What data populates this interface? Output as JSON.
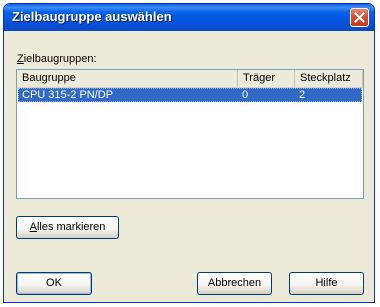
{
  "window": {
    "title": "Zielbaugruppe auswählen"
  },
  "group": {
    "label_mnemonic": "Z",
    "label_rest": "ielbaugruppen:"
  },
  "table": {
    "columns": [
      "Baugruppe",
      "Träger",
      "Steckplatz"
    ],
    "rows": [
      {
        "baugruppe": "CPU 315-2 PN/DP",
        "traeger": "0",
        "steckplatz": "2",
        "selected": true
      }
    ]
  },
  "buttons": {
    "select_all_mnemonic": "A",
    "select_all_rest": "lles markieren",
    "ok": "OK",
    "cancel": "Abbrechen",
    "help": "Hilfe"
  },
  "colors": {
    "titlebar": "#0551da",
    "selection": "#316ac5",
    "dialog_bg": "#ece9d8",
    "close_button": "#d4502e"
  },
  "icons": {
    "close": "close-x-icon"
  }
}
